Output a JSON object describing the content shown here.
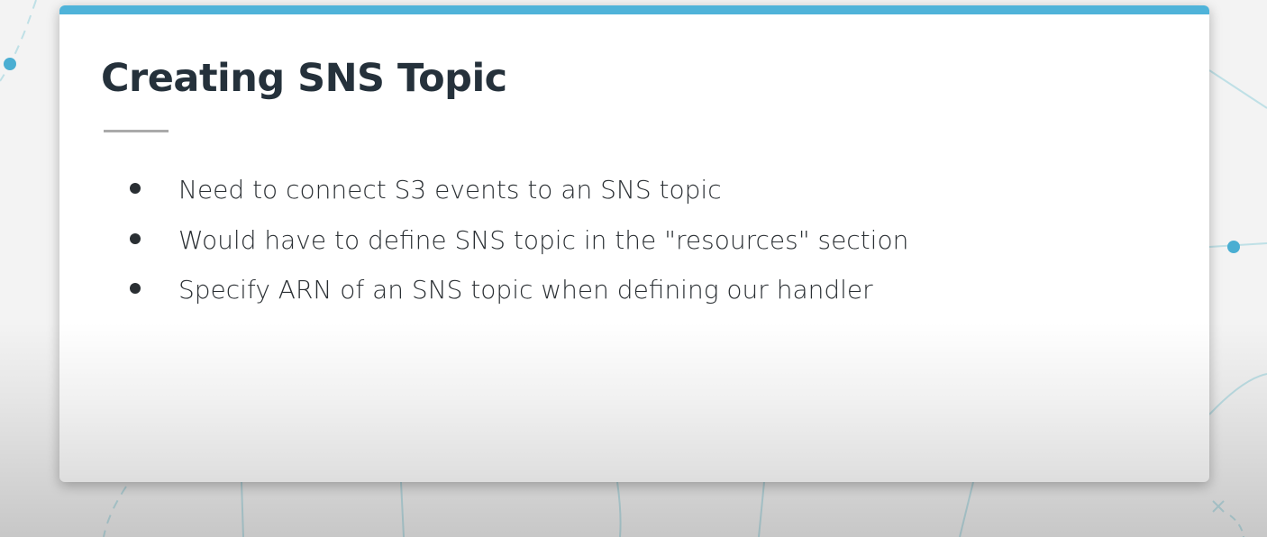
{
  "slide": {
    "title": "Creating SNS Topic",
    "bullets": [
      "Need to connect S3 events to an SNS topic",
      "Would have to define SNS topic in the \"resources\" section",
      "Specify ARN of an SNS topic when defining our handler"
    ]
  },
  "colors": {
    "accent": "#4fb3d9",
    "text": "#25313b"
  }
}
